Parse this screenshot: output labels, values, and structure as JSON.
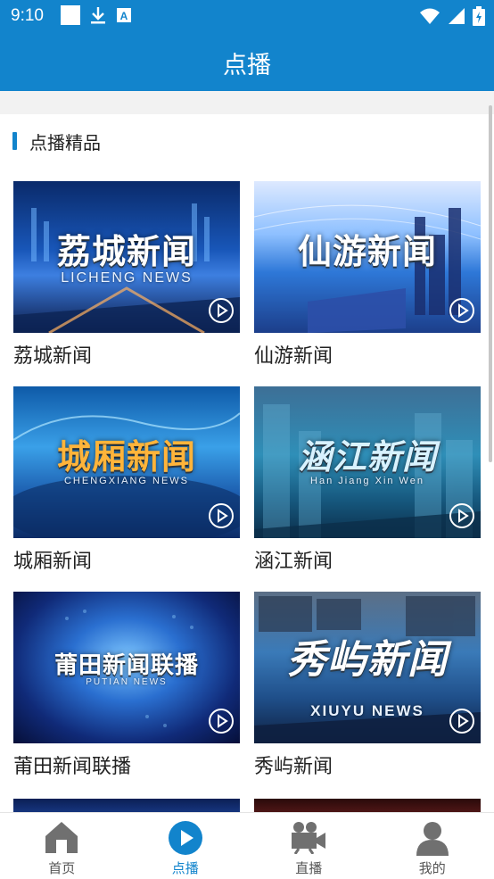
{
  "status": {
    "time": "9:10"
  },
  "appbar": {
    "title": "点播"
  },
  "section": {
    "title": "点播精品"
  },
  "cards": [
    {
      "label": "荔城新闻",
      "logo": "荔城新闻",
      "sub": "LICHENG NEWS"
    },
    {
      "label": "仙游新闻",
      "logo": "仙游新闻",
      "sub": ""
    },
    {
      "label": "城厢新闻",
      "logo": "城厢新闻",
      "sub": "CHENGXIANG NEWS"
    },
    {
      "label": "涵江新闻",
      "logo": "涵江新闻",
      "sub": "Han Jiang Xin Wen"
    },
    {
      "label": "莆田新闻联播",
      "logo": "莆田新闻联播",
      "sub": "PUTIAN NEWS"
    },
    {
      "label": "秀屿新闻",
      "logo": "秀屿新闻",
      "sub": "XIUYU NEWS"
    }
  ],
  "tabs": [
    {
      "label": "首页",
      "icon": "home-icon"
    },
    {
      "label": "点播",
      "icon": "play-circle-icon"
    },
    {
      "label": "直播",
      "icon": "video-camera-icon"
    },
    {
      "label": "我的",
      "icon": "user-icon"
    }
  ],
  "colors": {
    "accent": "#1284cc",
    "active_tab": "#1284cc",
    "inactive_tab": "#707070"
  }
}
